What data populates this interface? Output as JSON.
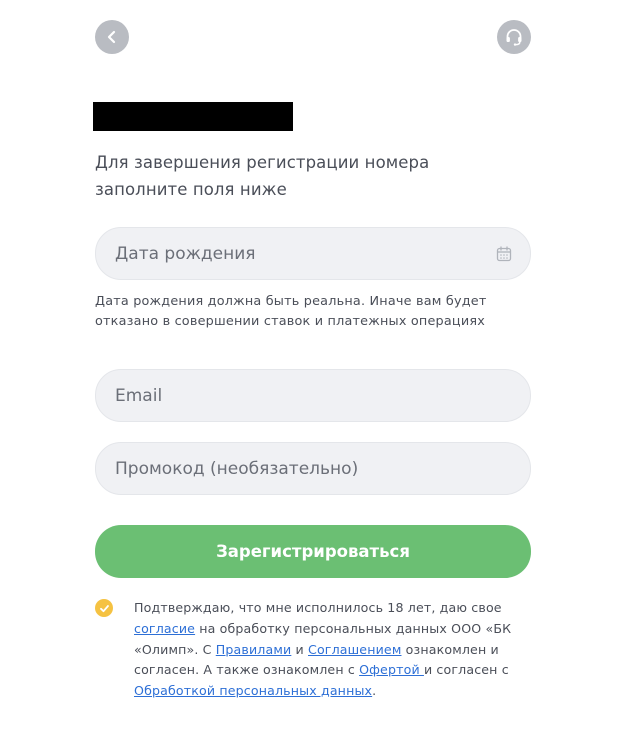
{
  "header": {
    "back_icon": "chevron-left-icon",
    "support_icon": "headset-icon"
  },
  "intro_text": "Для завершения регистрации номера заполните поля ниже",
  "form": {
    "dob_placeholder": "Дата рождения",
    "dob_icon": "calendar-icon",
    "dob_hint": "Дата рождения должна быть реальна. Иначе вам будет отказано в совершении ставок и платежных операциях",
    "email_placeholder": "Email",
    "promo_placeholder": "Промокод (необязательно)",
    "submit_label": "Зарегистрироваться"
  },
  "consent": {
    "checked": true,
    "part1": "Подтверждаю, что мне исполнилось 18 лет, даю свое ",
    "link_consent": "согласие",
    "part2": " на обработку персональных данных ООО «БК «Олимп». С ",
    "link_rules": "Правилами",
    "part3": " и ",
    "link_agreement": "Соглашением",
    "part4": " ознакомлен и согласен. А также ознакомлен с ",
    "link_offer": "Офертой ",
    "part5": " и согласен с ",
    "link_processing": "Обработкой персональных данных",
    "part6": "."
  },
  "colors": {
    "accent_green": "#6bbf73",
    "check_yellow": "#f5c242",
    "link_blue": "#2d6fd6",
    "icon_button_gray": "#b9bcc2",
    "field_bg": "#f0f1f4"
  }
}
